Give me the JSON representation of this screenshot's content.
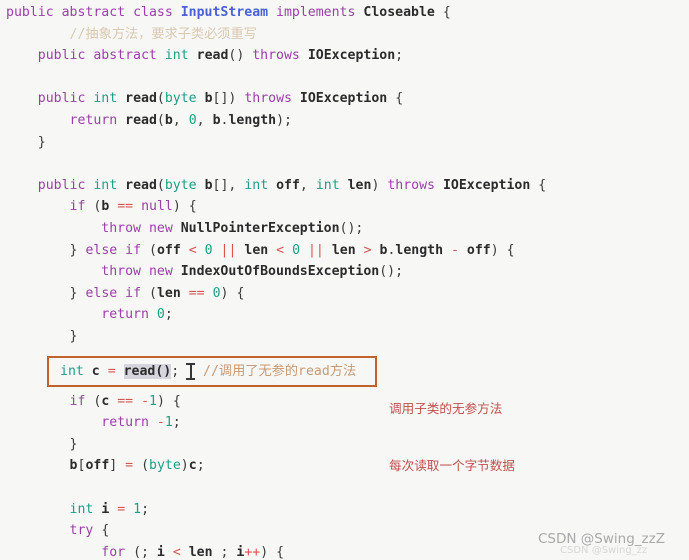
{
  "editor": {
    "language": "java",
    "background_color": "#f7f7f6",
    "lines": [
      "public abstract class InputStream implements Closeable {",
      "    //抽象方法，要求子类必须重写",
      "    public abstract int read() throws IOException;",
      "",
      "    public int read(byte b[]) throws IOException {",
      "        return read(b, 0, b.length);",
      "    }",
      "",
      "    public int read(byte b[], int off, int len) throws IOException {",
      "        if (b == null) {",
      "            throw new NullPointerException();",
      "        } else if (off < 0 || len < 0 || len > b.length - off) {",
      "            throw new IndexOutOfBoundsException();",
      "        } else if (len == 0) {",
      "            return 0;",
      "        }",
      "",
      "        int c = read(); //调用了无参的read方法",
      "        if (c == -1) {",
      "            return -1;",
      "        }",
      "        b[off] = (byte)c;",
      "",
      "        int i = 1;",
      "        try {",
      "            for (; i < len ; i++) {"
    ]
  },
  "highlight_box": {
    "border_color": "#c0622c",
    "code_prefix": "int c = ",
    "selected_text": "read()",
    "code_suffix": ";",
    "inline_comment": " //调用了无参的read方法",
    "selection_background": "#d6d4dd"
  },
  "caret": {
    "type": "i-beam-text-cursor",
    "color": "#35353a"
  },
  "annotations": {
    "color": "#c0504d",
    "notes": [
      "调用子类的无参方法",
      "每次读取一个字节数据"
    ]
  },
  "watermark": {
    "text": "CSDN @Swing_zzZ",
    "ghost_text": "CSDN @Swing_zz",
    "color": "#a9a9a9"
  },
  "syntax_colors": {
    "keyword": "#9b3fa8",
    "type": "#1f9e86",
    "number": "#1f9e86",
    "class_name": "#4a5fd8",
    "identifier": "#2b2b2b",
    "operator": "#d9534f",
    "comment": "#d9c9b0"
  }
}
